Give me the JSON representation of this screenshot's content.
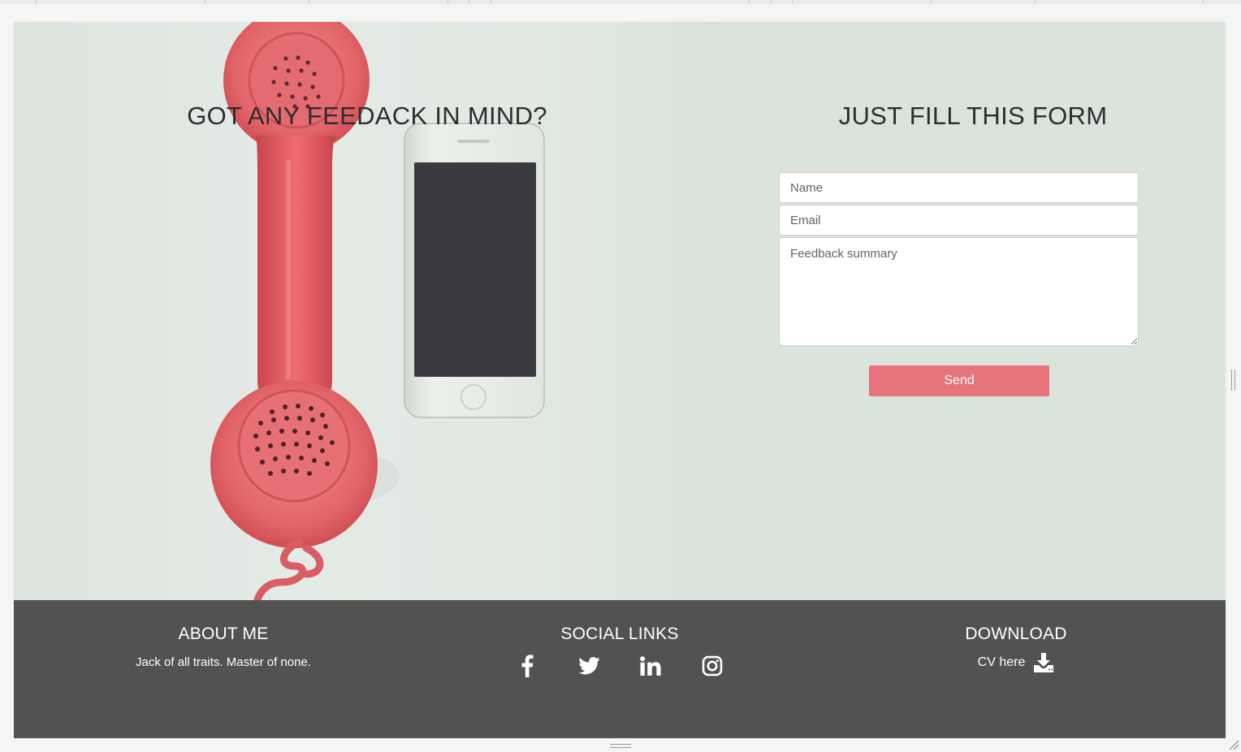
{
  "contact": {
    "left_title": "GOT ANY FEEDACK IN MIND?",
    "right_title": "JUST FILL THIS FORM",
    "form": {
      "name_placeholder": "Name",
      "email_placeholder": "Email",
      "summary_placeholder": "Feedback summary",
      "send_label": "Send"
    }
  },
  "footer": {
    "about": {
      "heading": "ABOUT ME",
      "text": "Jack of all traits. Master of none."
    },
    "social": {
      "heading": "SOCIAL LINKS",
      "icons": [
        "facebook-icon",
        "twitter-icon",
        "linkedin-icon",
        "instagram-icon"
      ]
    },
    "download": {
      "heading": "DOWNLOAD",
      "link_text": "CV here",
      "icon": "download-icon"
    }
  },
  "colors": {
    "accent": "#e6747a",
    "panel": "#dae3dc",
    "footer": "#525252"
  }
}
